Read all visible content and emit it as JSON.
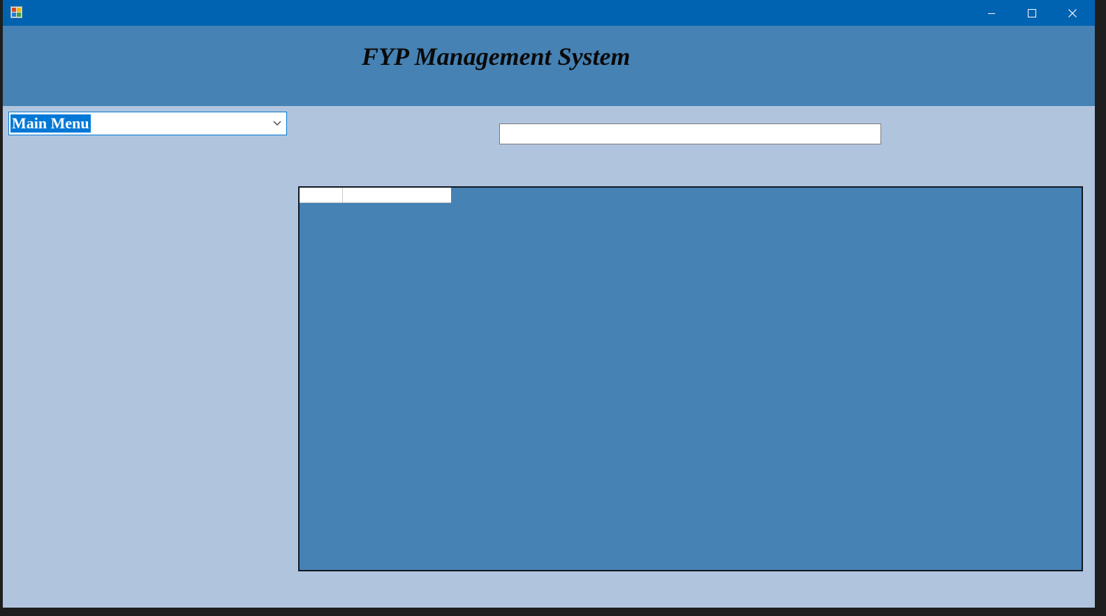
{
  "window": {
    "title": "",
    "controls": {
      "minimize_icon": "minimize-icon",
      "maximize_icon": "maximize-icon",
      "close_icon": "close-icon"
    }
  },
  "header": {
    "title": "FYP Management System"
  },
  "menu": {
    "selected": "Main Menu"
  },
  "search": {
    "value": "",
    "placeholder": ""
  },
  "grid": {
    "columns": [
      ""
    ],
    "rows": []
  },
  "colors": {
    "titlebar": "#0063b1",
    "header_band": "#4682b4",
    "background": "#b0c4de",
    "grid_background": "#4682b4",
    "selection": "#0078d7"
  }
}
